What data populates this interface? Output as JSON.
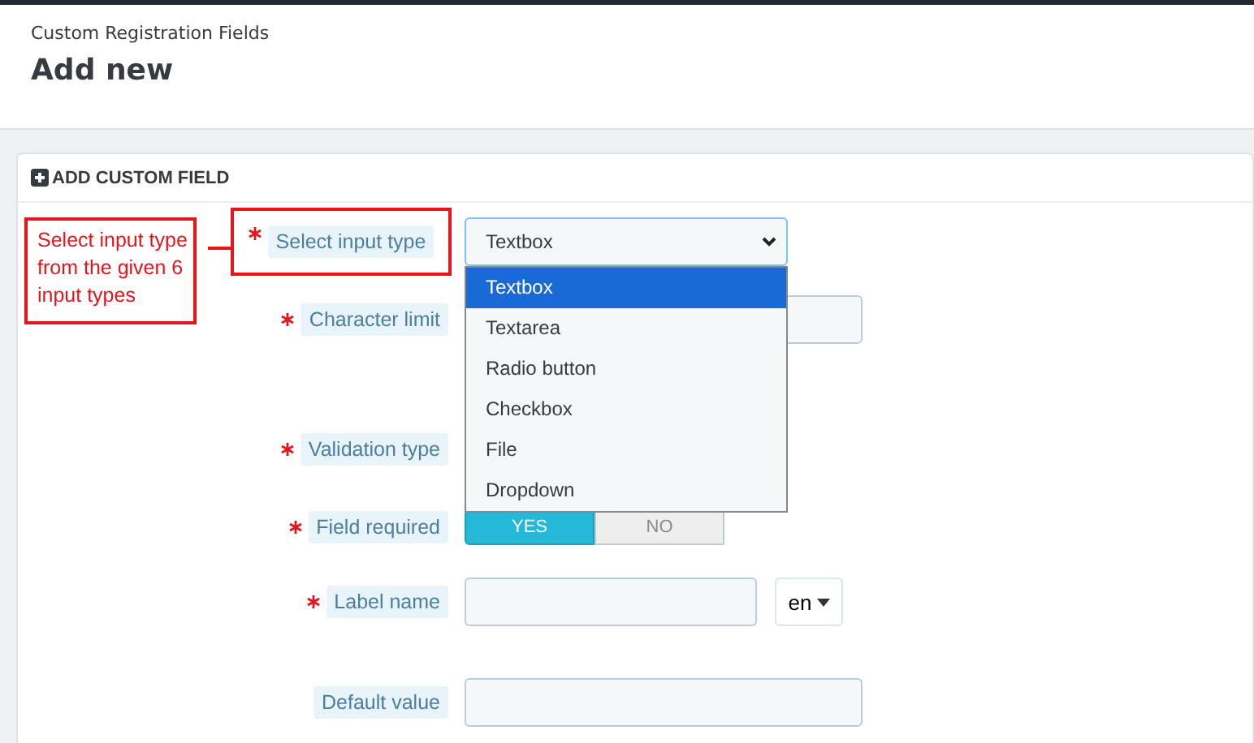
{
  "breadcrumb": "Custom Registration Fields",
  "page_title": "Add new",
  "panel": {
    "heading": "ADD CUSTOM FIELD"
  },
  "annotation": {
    "text": "Select input type from the given 6 input types"
  },
  "fields": [
    {
      "kind": "select",
      "label": "Select input type",
      "required": true,
      "value": "Textbox"
    },
    {
      "kind": "text",
      "label": "Character limit",
      "required": true
    },
    {
      "kind": "none",
      "label": "Validation type",
      "required": true
    },
    {
      "kind": "toggle",
      "label": "Field required",
      "required": true,
      "options": [
        {
          "label": "YES",
          "selected": true
        },
        {
          "label": "NO",
          "selected": false
        }
      ]
    },
    {
      "kind": "lang",
      "label": "Label name",
      "required": true,
      "language": "en"
    },
    {
      "kind": "text",
      "label": "Default value",
      "required": false
    }
  ],
  "dropdown": {
    "options": [
      {
        "label": "Textbox",
        "selected": true
      },
      {
        "label": "Textarea",
        "selected": false
      },
      {
        "label": "Radio button",
        "selected": false
      },
      {
        "label": "Checkbox",
        "selected": false
      },
      {
        "label": "File",
        "selected": false
      },
      {
        "label": "Dropdown",
        "selected": false
      }
    ]
  }
}
